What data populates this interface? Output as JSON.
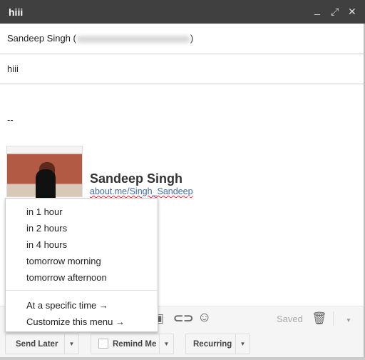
{
  "window": {
    "title": "hiii",
    "minimize_icon": "minimize-icon",
    "expand_icon": "expand-icon",
    "close_icon": "close-icon"
  },
  "recipients": {
    "name": "Sandeep Singh",
    "open_paren": "(",
    "close_paren": ")"
  },
  "subject": "hiii",
  "body": {
    "separator": "--",
    "signature_name": "Sandeep Singh",
    "signature_link": "about.me/Singh_Sandeep"
  },
  "send_later_menu": {
    "items": [
      "in 1 hour",
      "in 2 hours",
      "in 4 hours",
      "tomorrow morning",
      "tomorrow afternoon"
    ],
    "specific_time": "At a specific time →",
    "customize": "Customize this menu →"
  },
  "toolbar": {
    "status": "Saved",
    "icons": [
      "insert-photo-icon",
      "link-icon",
      "emoji-icon",
      "trash-icon",
      "more-options-icon"
    ]
  },
  "buttons": {
    "send_later": "Send Later",
    "remind_me": "Remind Me",
    "remind_me_checked": false,
    "recurring": "Recurring"
  }
}
